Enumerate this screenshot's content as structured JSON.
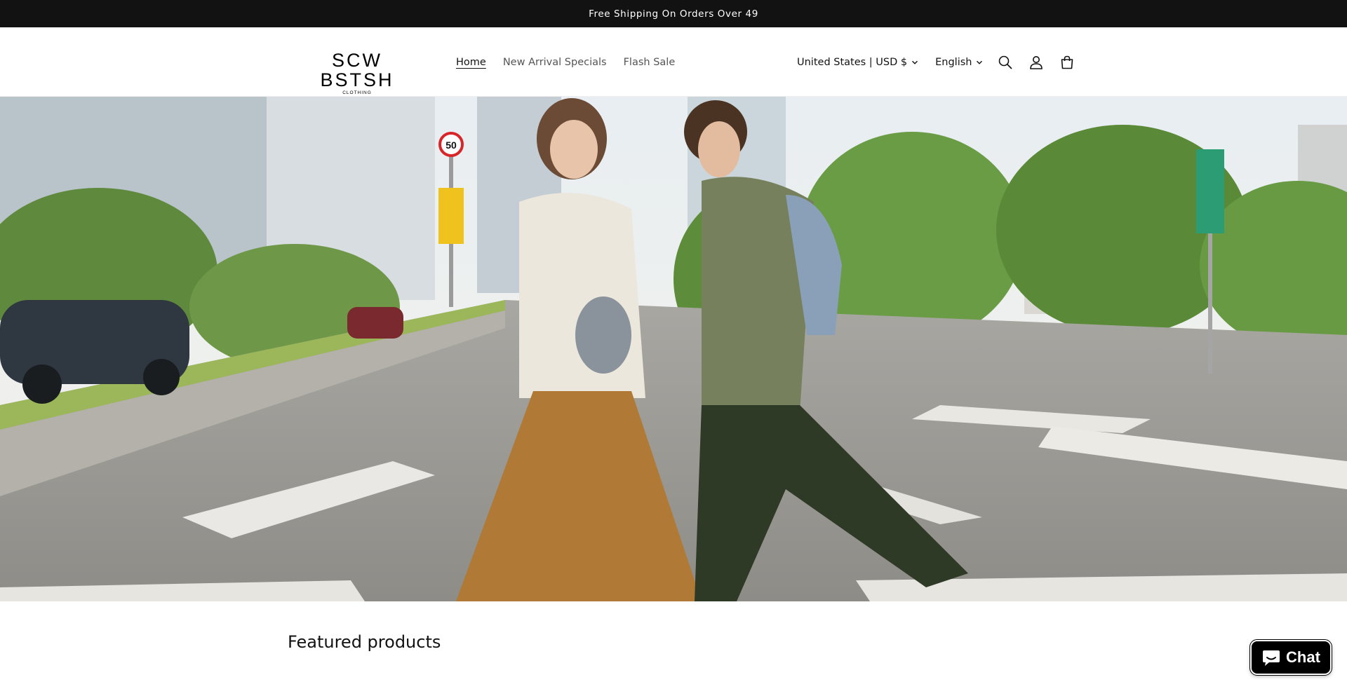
{
  "announcement": {
    "text": "Free Shipping On Orders Over   49"
  },
  "header": {
    "logo": {
      "main": "SCW BSTSH",
      "sub": "CLOTHING"
    },
    "nav": [
      {
        "label": "Home",
        "active": true
      },
      {
        "label": "New Arrival Specials",
        "active": false
      },
      {
        "label": "Flash Sale",
        "active": false
      }
    ],
    "country_selector": "United States | USD $",
    "language_selector": "English",
    "icons": [
      "search-icon",
      "account-icon",
      "cart-icon",
      "chevron-down-icon"
    ]
  },
  "hero": {
    "description_icon": "street-fashion-photo",
    "sign_speed_limit": "50"
  },
  "featured": {
    "title": "Featured products"
  },
  "chat": {
    "label": "Chat",
    "icon": "chat-bubble-icon"
  },
  "colors": {
    "announcement_bg": "#121212",
    "chat_bg": "#000000",
    "text": "#121212"
  }
}
